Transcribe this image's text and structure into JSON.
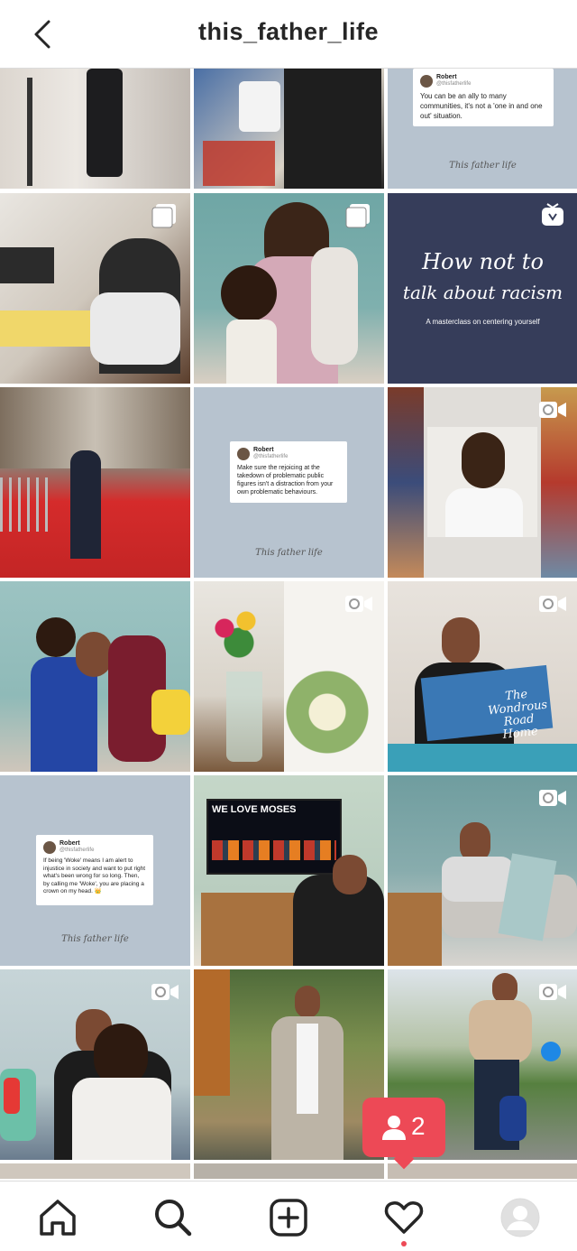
{
  "header": {
    "title": "this_father_life"
  },
  "posts": {
    "p3": {
      "tweet_name": "Robert",
      "tweet_handle": "@thisfatherlife",
      "tweet_text": "You can be an ally to many communities, it's not a 'one in and one out' situation.",
      "signature": "This father life"
    },
    "p6": {
      "title_line1": "How not to",
      "title_line2": "talk about racism",
      "subtitle": "A masterclass on centering yourself"
    },
    "p8": {
      "tweet_name": "Robert",
      "tweet_handle": "@thisfatherlife",
      "tweet_text": "Make sure the rejoicing at the takedown of problematic public figures isn't a distraction from your own problematic behaviours.",
      "signature": "This father life"
    },
    "p12": {
      "book_title": "The Wondrous Road Home"
    },
    "p13": {
      "tweet_name": "Robert",
      "tweet_handle": "@thisfatherlife",
      "tweet_text": "If being 'Woke' means I am alert to injustice in society and want to put right what's been wrong for so long. Then, by calling me 'Woke', you are placing a crown on my head. 👑",
      "signature": "This father life"
    },
    "p14": {
      "tv_text": "WE LOVE MOSES"
    }
  },
  "notification": {
    "count": "2",
    "icon": "person-icon"
  },
  "nav": {
    "items": [
      "home-icon",
      "search-icon",
      "add-post-icon",
      "activity-heart-icon",
      "profile-avatar"
    ]
  },
  "colors": {
    "notification": "#ed4956",
    "post_gray": "#b7c3cf",
    "navy_post": "#363d5a"
  }
}
